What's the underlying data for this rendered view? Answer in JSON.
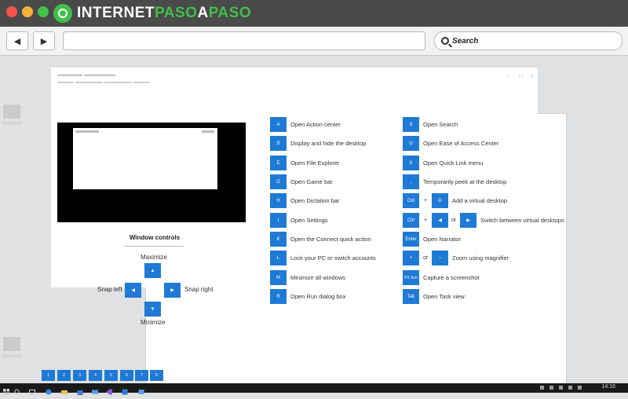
{
  "site": {
    "logo_part1": "INTERNET",
    "logo_part2": "PASO",
    "logo_part3": "A",
    "logo_part4": "PASO"
  },
  "browser": {
    "back_glyph": "◀",
    "forward_glyph": "▶",
    "search_placeholder": "Search"
  },
  "window": {
    "controls_title": "Window controls"
  },
  "arrows": {
    "up": {
      "glyph": "▲",
      "label": "Maximize"
    },
    "left": {
      "glyph": "◀",
      "label": "Snap left"
    },
    "right": {
      "glyph": "▶",
      "label": "Snap right"
    },
    "down": {
      "glyph": "▼",
      "label": "Minimize"
    }
  },
  "left_shortcuts": [
    {
      "key": "A",
      "label": "Open Action center"
    },
    {
      "key": "D",
      "label": "Display and hide the desktop"
    },
    {
      "key": "E",
      "label": "Open File Explorer"
    },
    {
      "key": "G",
      "label": "Open Game bar"
    },
    {
      "key": "H",
      "label": "Open Dictation bar"
    },
    {
      "key": "I",
      "label": "Open Settings"
    },
    {
      "key": "K",
      "label": "Open the Connect quick action"
    },
    {
      "key": "L",
      "label": "Lock your PC or switch accounts"
    },
    {
      "key": "M",
      "label": "Minimize all windows"
    },
    {
      "key": "R",
      "label": "Open Run dialog box"
    }
  ],
  "right_shortcuts": {
    "s": {
      "key": "S",
      "label": "Open Search"
    },
    "u": {
      "key": "U",
      "label": "Open Ease of Access Center"
    },
    "x": {
      "key": "X",
      "label": "Open Quick Link menu"
    },
    "comma": {
      "key": ",",
      "label": "Temporarily peek at the desktop"
    },
    "ctrl_d": {
      "key1": "Ctrl",
      "op1": "+",
      "key2": "D",
      "label": "Add a virtual desktop"
    },
    "ctrl_arrows": {
      "key1": "Ctrl",
      "op1": "+",
      "key2": "◀",
      "op2": "or",
      "key3": "▶",
      "label": "Switch between virtual desktops"
    },
    "enter": {
      "key": "Enter",
      "label": "Open Narrator"
    },
    "zoom": {
      "key1": "+",
      "op1": "or",
      "key2": "−",
      "label": "Zoom using magnifier"
    },
    "prtscn": {
      "key": "Prt Scn",
      "label": "Capture a screenshot"
    },
    "tab": {
      "key": "Tab",
      "label": "Open Task view"
    }
  },
  "number_keys": [
    "1",
    "2",
    "3",
    "4",
    "5",
    "6",
    "7",
    "8"
  ],
  "taskbar": {
    "clock": "14:16"
  },
  "colors": {
    "key_blue": "#1f7ad6",
    "taskbar": "#1a1a1a",
    "brand_green": "#3fbf4b"
  }
}
